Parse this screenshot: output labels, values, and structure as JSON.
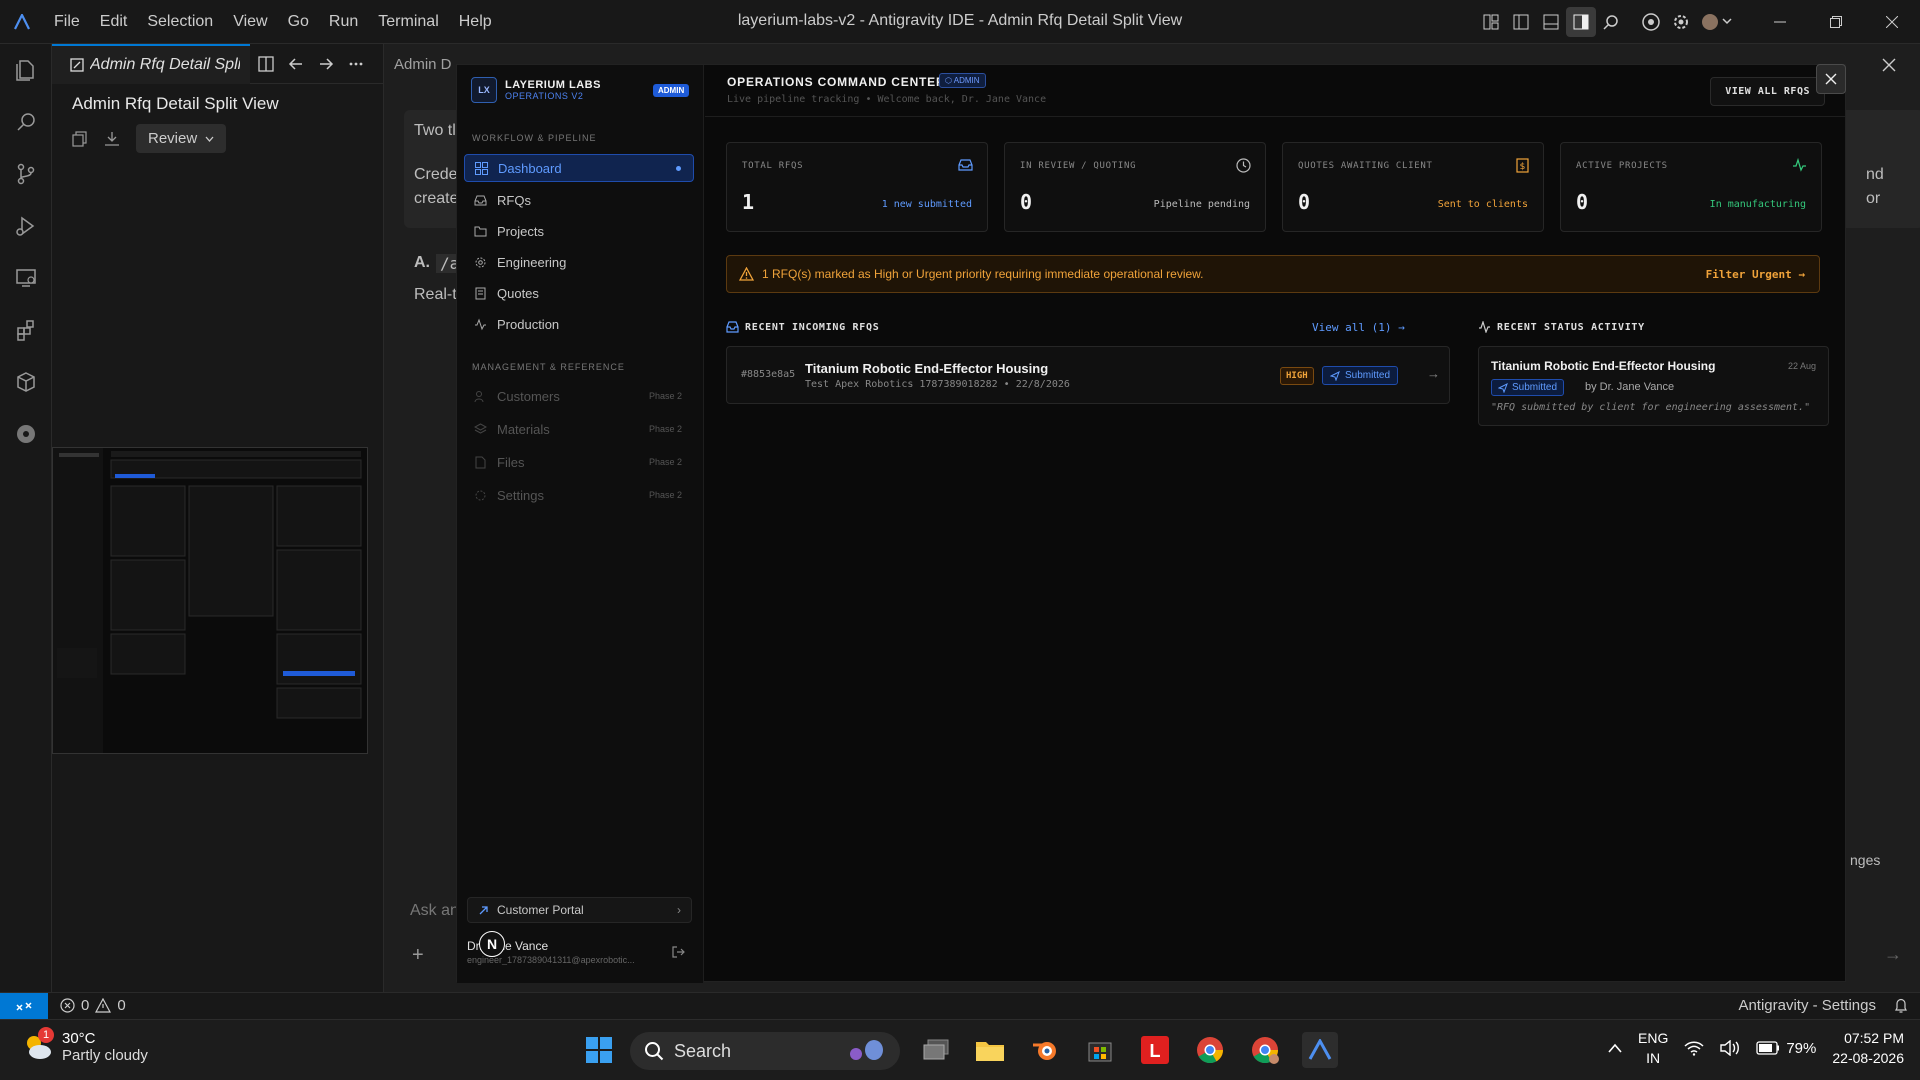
{
  "window": {
    "title": "layerium-labs-v2 - Antigravity IDE - Admin Rfq Detail Split View",
    "menu": [
      "File",
      "Edit",
      "Selection",
      "View",
      "Go",
      "Run",
      "Terminal",
      "Help"
    ]
  },
  "left_panel": {
    "tab_label": "Admin Rfq Detail Split View",
    "doc_title": "Admin Rfq Detail Split View",
    "review_label": "Review"
  },
  "bg_editor": {
    "tab_text": "Admin D",
    "frag_two": "Two tl",
    "frag_crede": "Crede",
    "frag_create": "create",
    "frag_a": "A.",
    "frag_path": "/a",
    "frag_real": "Real-t",
    "frag_nd": "nd",
    "frag_or": "or",
    "frag_changes": "nges",
    "frag_ask": "Ask an"
  },
  "modal": {
    "brand_name": "LAYERIUM LABS",
    "brand_sub": "OPERATIONS V2",
    "logo_text": "LX",
    "admin_pill": "ADMIN",
    "section_workflow": "WORKFLOW & PIPELINE",
    "section_mgmt": "MANAGEMENT & REFERENCE",
    "nav_workflow": [
      {
        "label": "Dashboard",
        "icon": "grid-icon"
      },
      {
        "label": "RFQs",
        "icon": "inbox-icon"
      },
      {
        "label": "Projects",
        "icon": "folder-icon"
      },
      {
        "label": "Engineering",
        "icon": "gear-icon"
      },
      {
        "label": "Quotes",
        "icon": "document-icon"
      },
      {
        "label": "Production",
        "icon": "activity-icon"
      }
    ],
    "nav_mgmt": [
      {
        "label": "Customers",
        "phase": "Phase 2"
      },
      {
        "label": "Materials",
        "phase": "Phase 2"
      },
      {
        "label": "Files",
        "phase": "Phase 2"
      },
      {
        "label": "Settings",
        "phase": "Phase 2"
      }
    ],
    "portal_label": "Customer Portal",
    "user_name": "Dr. Jane Vance",
    "user_email": "engineer_1787389041311@apexrobotic...",
    "avatar_letter": "N",
    "header_title": "OPERATIONS COMMAND CENTER",
    "header_badge": "ADMIN",
    "header_sub": "Live pipeline tracking • Welcome back, Dr. Jane Vance",
    "view_all_rfqs": "VIEW ALL RFQS",
    "stats": [
      {
        "label": "TOTAL RFQS",
        "value": "1",
        "sub": "1 new submitted",
        "color": "#5f9bff",
        "icon": "inbox-icon"
      },
      {
        "label": "IN REVIEW / QUOTING",
        "value": "0",
        "sub": "Pipeline pending",
        "color": "#bbbbbb",
        "icon": "clock-icon"
      },
      {
        "label": "QUOTES AWAITING CLIENT",
        "value": "0",
        "sub": "Sent to clients",
        "color": "#f0a33a",
        "icon": "dollar-icon"
      },
      {
        "label": "ACTIVE PROJECTS",
        "value": "0",
        "sub": "In manufacturing",
        "color": "#34c77b",
        "icon": "activity-icon"
      }
    ],
    "alert_text": "1 RFQ(s) marked as High or Urgent priority requiring immediate operational review.",
    "alert_action": "Filter Urgent →",
    "recent_rfqs_title": "RECENT INCOMING RFQS",
    "recent_rfqs_link": "View all (1) →",
    "rfq": {
      "id": "#8853e8a5",
      "title": "Titanium Robotic End-Effector Housing",
      "sub": "Test Apex Robotics 1787389018282 • 22/8/2026",
      "priority": "HIGH",
      "status": "Submitted"
    },
    "activity_title": "RECENT STATUS ACTIVITY",
    "activity": {
      "title": "Titanium Robotic End-Effector Housing",
      "date": "22 Aug",
      "status": "Submitted",
      "by": "by Dr. Jane Vance",
      "note": "\"RFQ submitted by client for engineering assessment.\""
    }
  },
  "statusbar": {
    "errors": "0",
    "warnings": "0",
    "right_text": "Antigravity - Settings"
  },
  "taskbar": {
    "temperature": "30°C",
    "weather": "Partly cloudy",
    "weather_badge": "1",
    "search_label": "Search",
    "lang1": "ENG",
    "lang2": "IN",
    "battery": "79%",
    "time": "07:52 PM",
    "date": "22-08-2026"
  }
}
